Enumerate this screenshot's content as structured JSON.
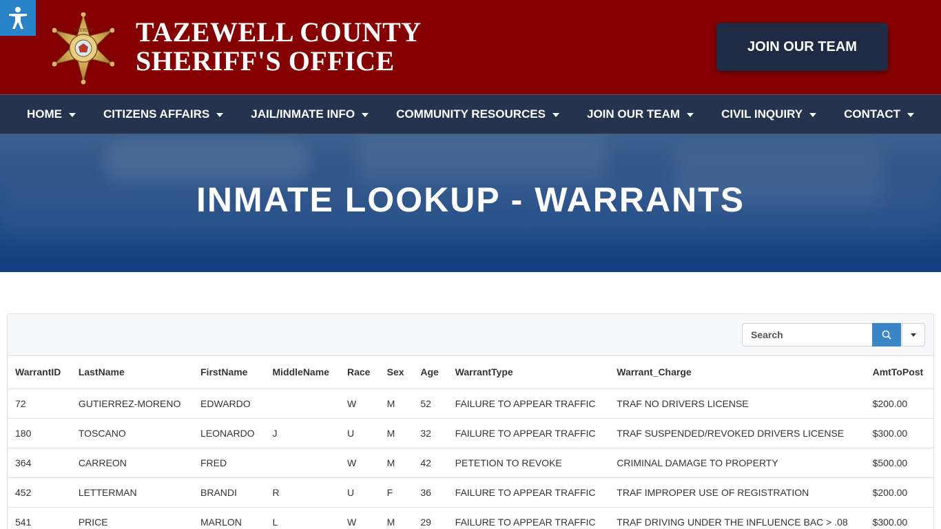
{
  "header": {
    "title_line1": "TAZEWELL COUNTY",
    "title_line2": "SHERIFF'S OFFICE",
    "join_button": "JOIN OUR TEAM",
    "brand_color": "#850000"
  },
  "nav": {
    "items": [
      {
        "label": "HOME"
      },
      {
        "label": "CITIZENS AFFAIRS"
      },
      {
        "label": "JAIL/INMATE INFO"
      },
      {
        "label": "COMMUNITY RESOURCES"
      },
      {
        "label": "JOIN OUR TEAM"
      },
      {
        "label": "CIVIL INQUIRY"
      },
      {
        "label": "CONTACT"
      }
    ]
  },
  "hero": {
    "title": "INMATE LOOKUP - WARRANTS"
  },
  "search": {
    "placeholder": "Search"
  },
  "table": {
    "columns": [
      "WarrantID",
      "LastName",
      "FirstName",
      "MiddleName",
      "Race",
      "Sex",
      "Age",
      "WarrantType",
      "Warrant_Charge",
      "AmtToPost"
    ],
    "rows": [
      [
        "72",
        "GUTIERREZ-MORENO",
        "EDWARDO",
        "",
        "W",
        "M",
        "52",
        "FAILURE TO APPEAR TRAFFIC",
        "TRAF NO DRIVERS LICENSE",
        "$200.00"
      ],
      [
        "180",
        "TOSCANO",
        "LEONARDO",
        "J",
        "U",
        "M",
        "32",
        "FAILURE TO APPEAR TRAFFIC",
        "TRAF SUSPENDED/REVOKED DRIVERS LICENSE",
        "$300.00"
      ],
      [
        "364",
        "CARREON",
        "FRED",
        "",
        "W",
        "M",
        "42",
        "PETETION TO REVOKE",
        "CRIMINAL DAMAGE TO PROPERTY",
        "$500.00"
      ],
      [
        "452",
        "LETTERMAN",
        "BRANDI",
        "R",
        "U",
        "F",
        "36",
        "FAILURE TO APPEAR TRAFFIC",
        "TRAF IMPROPER USE OF REGISTRATION",
        "$200.00"
      ],
      [
        "541",
        "PRICE",
        "MARLON",
        "L",
        "W",
        "M",
        "29",
        "FAILURE TO APPEAR TRAFFIC",
        "TRAF DRIVING UNDER THE INFLUENCE BAC > .08",
        "$300.00"
      ]
    ]
  }
}
